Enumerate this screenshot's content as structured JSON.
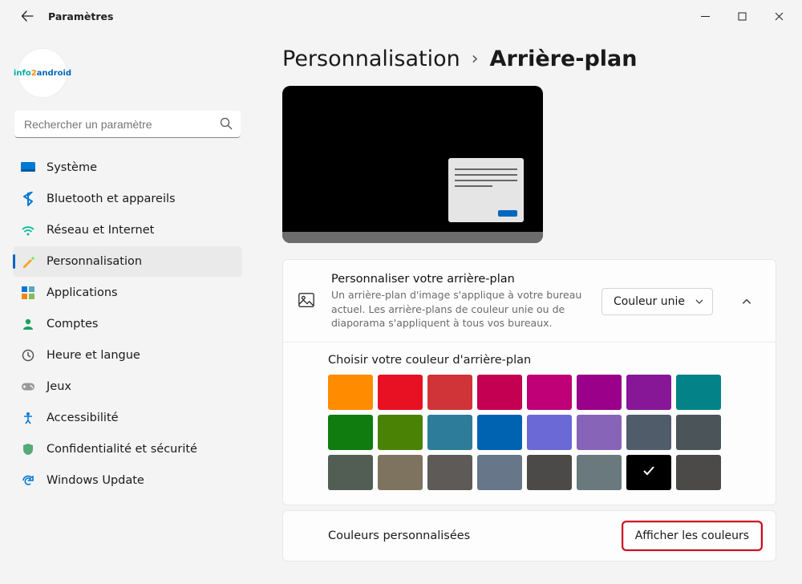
{
  "window": {
    "title": "Paramètres"
  },
  "search": {
    "placeholder": "Rechercher un paramètre"
  },
  "nav": {
    "items": [
      {
        "label": "Système",
        "icon": "system"
      },
      {
        "label": "Bluetooth et appareils",
        "icon": "bluetooth"
      },
      {
        "label": "Réseau et Internet",
        "icon": "network"
      },
      {
        "label": "Personnalisation",
        "icon": "personalization",
        "active": true
      },
      {
        "label": "Applications",
        "icon": "apps"
      },
      {
        "label": "Comptes",
        "icon": "accounts"
      },
      {
        "label": "Heure et langue",
        "icon": "time"
      },
      {
        "label": "Jeux",
        "icon": "gaming"
      },
      {
        "label": "Accessibilité",
        "icon": "accessibility"
      },
      {
        "label": "Confidentialité et sécurité",
        "icon": "privacy"
      },
      {
        "label": "Windows Update",
        "icon": "update"
      }
    ]
  },
  "breadcrumb": {
    "parent": "Personnalisation",
    "current": "Arrière-plan"
  },
  "bg_card": {
    "title": "Personnaliser votre arrière-plan",
    "desc": "Un arrière-plan d'image s'applique à votre bureau actuel. Les arrière-plans de couleur unie ou de diaporama s'appliquent à tous vos bureaux.",
    "dropdown_value": "Couleur unie"
  },
  "color_section": {
    "label": "Choisir votre couleur d'arrière-plan",
    "swatches": [
      "#ff8c00",
      "#e81123",
      "#d13438",
      "#c30052",
      "#bf0077",
      "#9a0089",
      "#881798",
      "#038387",
      "#107c10",
      "#498205",
      "#2d7d9a",
      "#0063b1",
      "#6b69d6",
      "#8764b8",
      "#515c6b",
      "#4a5459",
      "#525e54",
      "#7e735f",
      "#5d5a58",
      "#68768a",
      "#4c4a48",
      "#69797e",
      "#000000",
      "#4c4a48"
    ],
    "selected_index": 22
  },
  "custom": {
    "label": "Couleurs personnalisées",
    "button": "Afficher les couleurs"
  }
}
